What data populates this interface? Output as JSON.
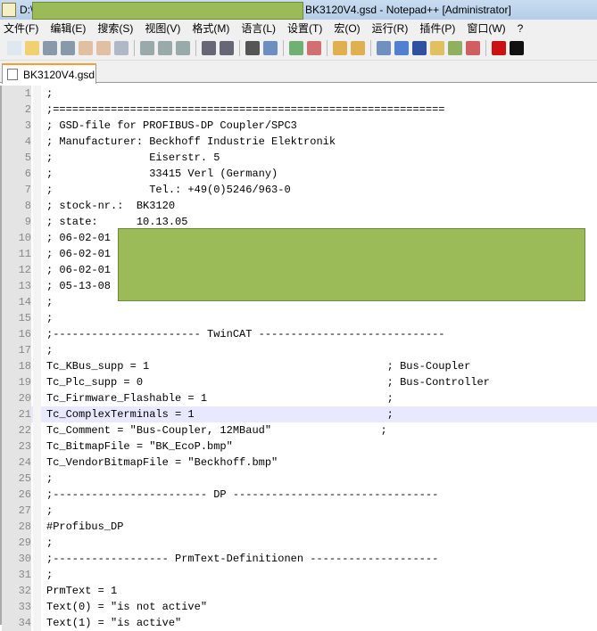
{
  "window": {
    "title_prefix": "D:\\",
    "title_suffix": "BK3120V4.gsd - Notepad++ [Administrator]"
  },
  "menu": [
    "文件(F)",
    "编辑(E)",
    "搜索(S)",
    "视图(V)",
    "格式(M)",
    "语言(L)",
    "设置(T)",
    "宏(O)",
    "运行(R)",
    "插件(P)",
    "窗口(W)",
    "?"
  ],
  "toolbar": [
    "new",
    "open",
    "save",
    "save-all",
    "close",
    "close-all",
    "print",
    "cut",
    "copy",
    "paste",
    "undo",
    "redo",
    "find",
    "replace",
    "zoom-in",
    "zoom-out",
    "sync-v",
    "sync-h",
    "word-wrap",
    "show-all-chars",
    "indent-guide",
    "udl",
    "doc-map",
    "function-list",
    "record-macro",
    "stop-macro"
  ],
  "tab": {
    "label": "BK3120V4.gsd"
  },
  "editor": {
    "current_line": 21,
    "lines": [
      ";",
      ";=============================================================",
      "; GSD-file for PROFIBUS-DP Coupler/SPC3",
      "; Manufacturer: Beckhoff Industrie Elektronik",
      ";               Eiserstr. 5",
      ";               33415 Verl (Germany)",
      ";               Tel.: +49(0)5246/963-0",
      "; stock-nr.:  BK3120",
      "; state:      10.13.05",
      "; 06-02-01",
      "; 06-02-01",
      "; 06-02-01",
      "; 05-13-08",
      ";",
      ";",
      ";----------------------- TwinCAT -----------------------------",
      ";",
      "Tc_KBus_supp = 1                                     ; Bus-Coupler",
      "Tc_Plc_supp = 0                                      ; Bus-Controller",
      "Tc_Firmware_Flashable = 1                            ;",
      "Tc_ComplexTerminals = 1                              ;",
      "Tc_Comment = \"Bus-Coupler, 12MBaud\"                 ;",
      "Tc_BitmapFile = \"BK_EcoP.bmp\"",
      "Tc_VendorBitmapFile = \"Beckhoff.bmp\"",
      ";",
      ";------------------------ DP --------------------------------",
      ";",
      "#Profibus_DP",
      ";",
      ";------------------ PrmText-Definitionen --------------------",
      ";",
      "PrmText = 1",
      "Text(0) = \"is not active\"",
      "Text(1) = \"is active\""
    ]
  }
}
